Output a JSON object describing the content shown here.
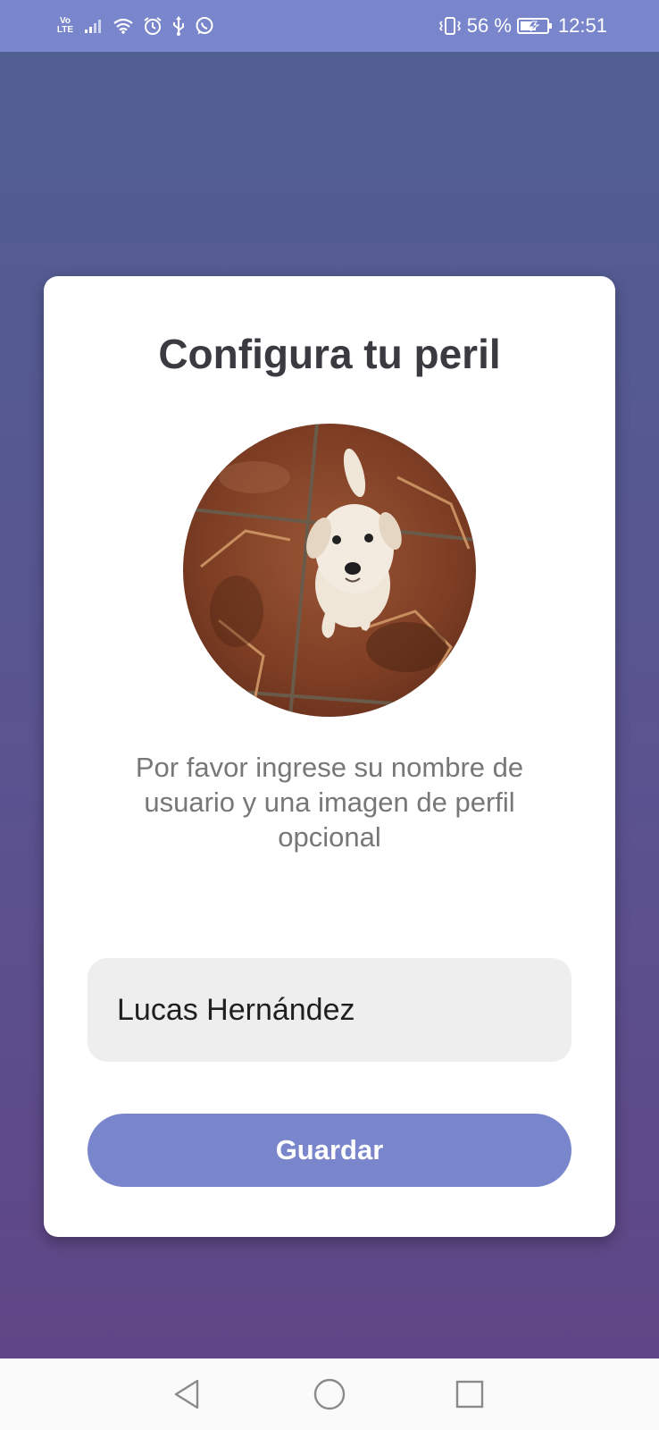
{
  "status_bar": {
    "network_label": "Vo LTE",
    "battery_percent": "56 %",
    "time": "12:51",
    "icons": [
      "volte-icon",
      "signal-icon",
      "wifi-icon",
      "alarm-icon",
      "usb-icon",
      "whatsapp-icon",
      "vibrate-icon",
      "battery-charging-icon"
    ],
    "background_color": "#7986cb"
  },
  "card": {
    "title": "Configura tu peril",
    "avatar": {
      "description_icon": "profile-photo-puppy"
    },
    "helper_text": "Por favor ingrese su nombre de usuario y una imagen de perfil opcional",
    "name_input": {
      "value": "Lucas Hernández"
    },
    "save_button_label": "Guardar"
  },
  "nav_bar": {
    "buttons": [
      "back-icon",
      "home-icon",
      "recents-icon"
    ]
  },
  "colors": {
    "accent": "#7986cb",
    "gradient_top": "#515f93",
    "gradient_bottom": "#604686",
    "title_text": "#3a3a40",
    "helper_text": "#777777"
  }
}
